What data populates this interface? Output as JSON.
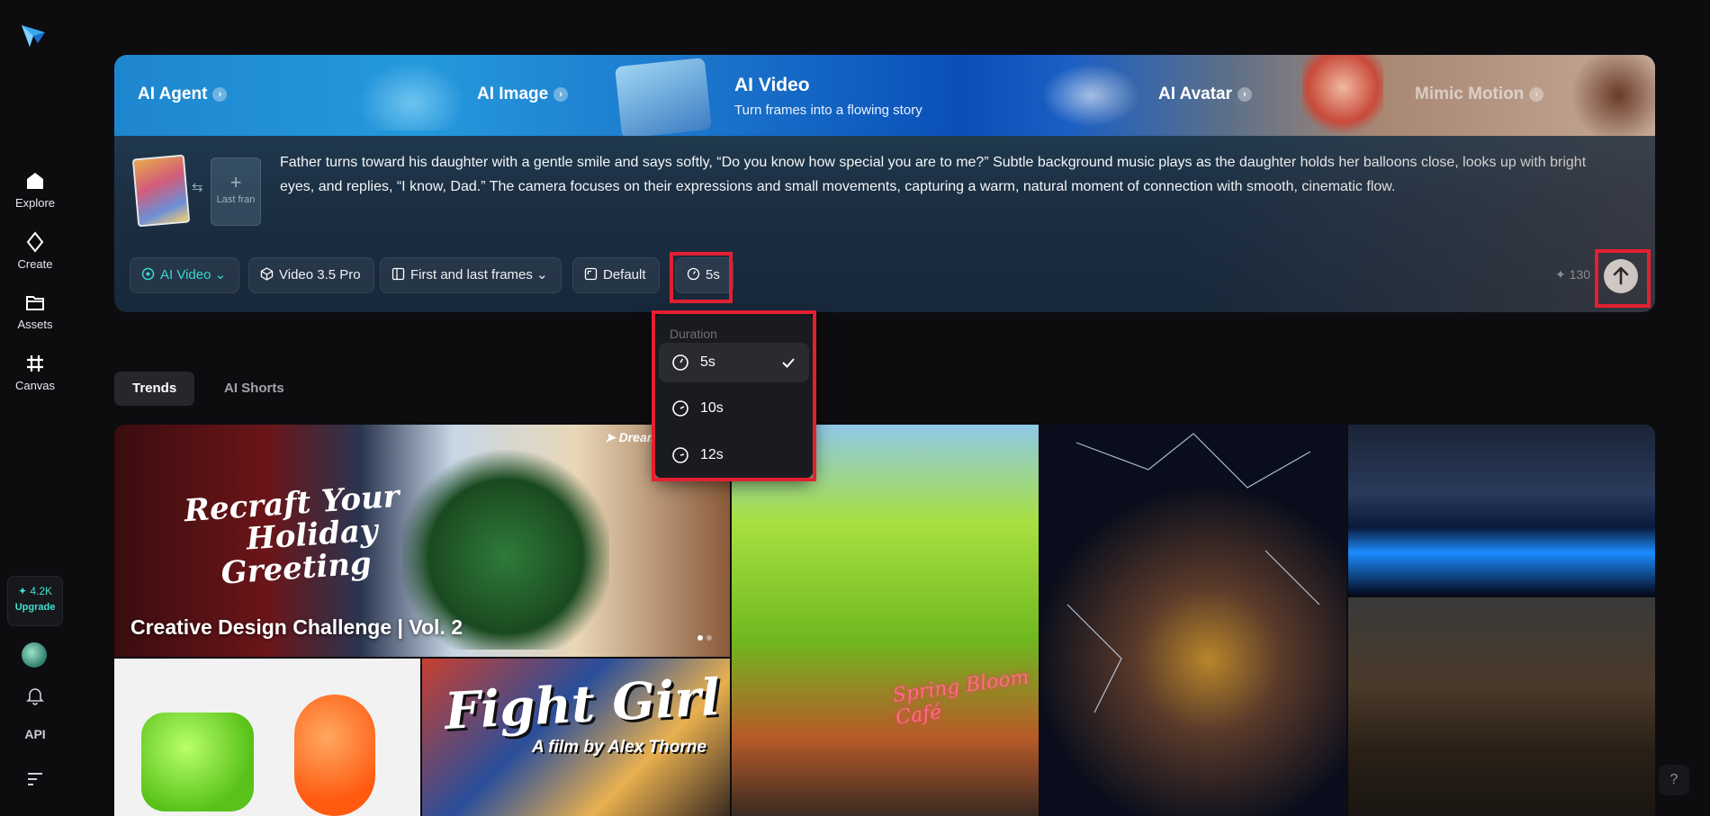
{
  "sidebar": {
    "nav": [
      {
        "label": "Explore",
        "icon": "home-icon"
      },
      {
        "label": "Create",
        "icon": "sparkle-diamond-icon"
      },
      {
        "label": "Assets",
        "icon": "folder-icon"
      },
      {
        "label": "Canvas",
        "icon": "canvas-grid-icon"
      }
    ],
    "credits": "4.2K",
    "upgrade_label": "Upgrade",
    "api_label": "API"
  },
  "banner": {
    "tabs": [
      {
        "label": "AI Agent"
      },
      {
        "label": "AI Image"
      },
      {
        "label": "AI Avatar"
      },
      {
        "label": "Mimic Motion"
      }
    ],
    "active": {
      "title": "AI Video",
      "subtitle": "Turn frames into a flowing story"
    }
  },
  "prompt": {
    "last_frame_label": "Last fran",
    "text": "Father turns toward his daughter with a gentle smile and says softly, “Do you know how special you are to me?” Subtle background music plays as the daughter holds her balloons close, looks up with bright eyes, and replies, “I know, Dad.” The camera focuses on their expressions and small movements, capturing a warm, natural moment of connection with smooth, cinematic flow."
  },
  "toolbar": {
    "mode": "AI Video",
    "model": "Video 3.5 Pro",
    "frames": "First and last frames",
    "ratio": "Default",
    "duration": "5s",
    "cost": "130"
  },
  "duration_menu": {
    "heading": "Duration",
    "options": [
      {
        "label": "5s",
        "selected": true
      },
      {
        "label": "10s",
        "selected": false
      },
      {
        "label": "12s",
        "selected": false
      }
    ]
  },
  "content_tabs": [
    {
      "label": "Trends",
      "active": true
    },
    {
      "label": "AI Shorts",
      "active": false
    }
  ],
  "gallery": {
    "featured_title": "Creative Design Challenge | Vol. 2",
    "featured_art_text": [
      "Recraft Your",
      "Holiday",
      "Greeting"
    ],
    "watermark": "Dream",
    "fight_girl_title": "Fight Girl",
    "fight_girl_sub": "A film by Alex Thorne",
    "cafe_sign": "Spring Bloom Café"
  },
  "colors": {
    "accent": "#39d6d0",
    "highlight": "#e32031",
    "background": "#0d0d10"
  }
}
